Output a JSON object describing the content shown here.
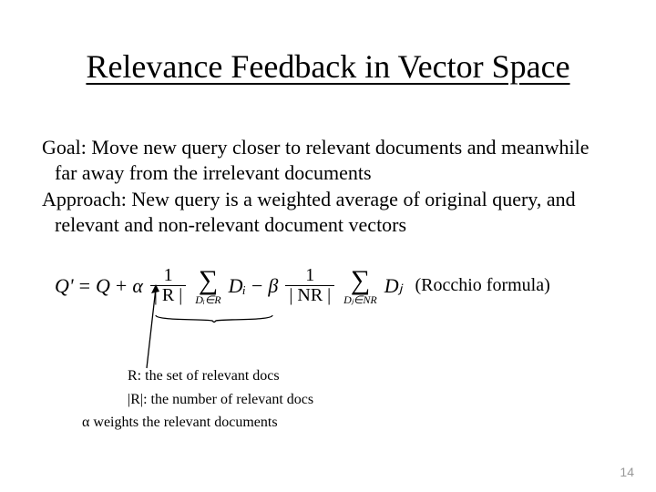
{
  "title": "Relevance Feedback in Vector Space",
  "body": {
    "p1": "Goal: Move new query closer to relevant documents and meanwhile far away from the irrelevant documents",
    "p2": "Approach: New query is a weighted average of original query, and relevant and non-relevant document vectors"
  },
  "formula": {
    "lhs": "Q' ",
    "eq1": "= ",
    "Q": "Q",
    "plus": " + ",
    "alpha": "α",
    "frac1_num": "1",
    "frac1_den": "| R |",
    "sum1_sub": "Dᵢ∈R",
    "Di": "Dᵢ",
    "minus": " − ",
    "beta": "β",
    "frac2_num": "1",
    "frac2_den": "| NR |",
    "sum2_sub": "Dⱼ∈NR",
    "Dj": "Dⱼ",
    "label": "(Rocchio formula)"
  },
  "notes": {
    "n1": "R: the set of relevant docs",
    "n2": "|R|: the number of relevant docs",
    "n3": "α weights the relevant documents"
  },
  "page_number": "14"
}
